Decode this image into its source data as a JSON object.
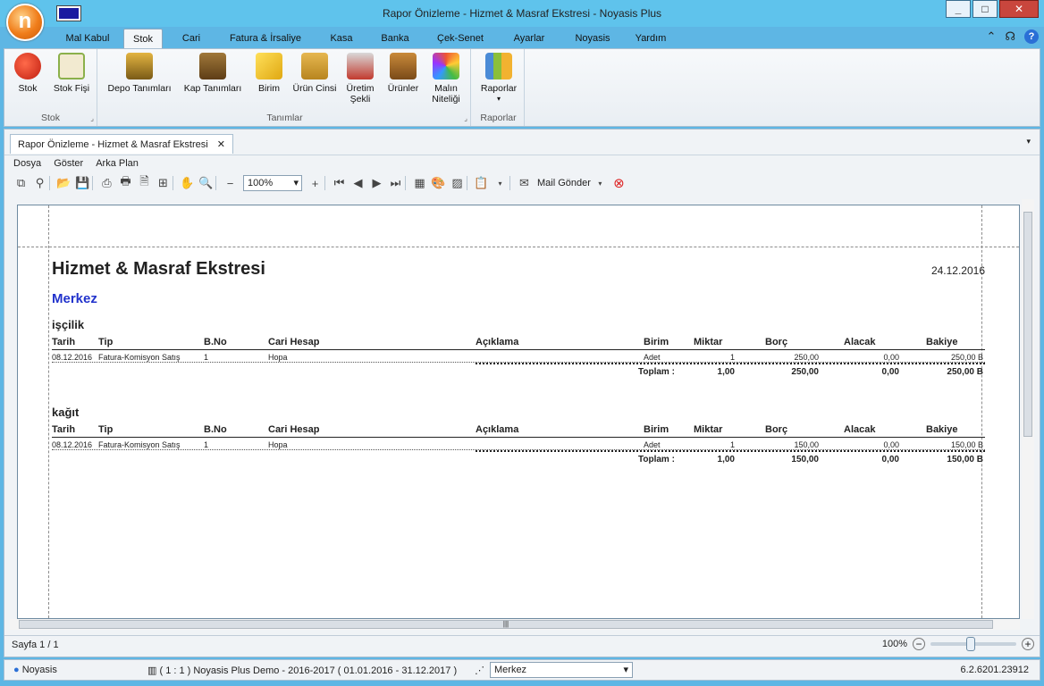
{
  "window": {
    "title": "Rapor Önizleme - Hizmet & Masraf Ekstresi - Noyasis Plus"
  },
  "ribbon_tabs": [
    "Mal Kabul",
    "Stok",
    "Cari",
    "Fatura & İrsaliye",
    "Kasa",
    "Banka",
    "Çek-Senet",
    "Ayarlar",
    "Noyasis",
    "Yardım"
  ],
  "ribbon": {
    "stok_group": {
      "label": "Stok",
      "buttons": [
        "Stok",
        "Stok Fişi"
      ]
    },
    "tanimlar_group": {
      "label": "Tanımlar",
      "buttons": [
        "Depo Tanımları",
        "Kap Tanımları",
        "Birim",
        "Ürün Cinsi",
        "Üretim Şekli",
        "Ürünler",
        "Malın Niteliği"
      ]
    },
    "raporlar_group": {
      "label": "Raporlar",
      "buttons": [
        "Raporlar"
      ]
    }
  },
  "doc_tab": {
    "label": "Rapor Önizleme - Hizmet & Masraf Ekstresi"
  },
  "menu": [
    "Dosya",
    "Göster",
    "Arka Plan"
  ],
  "toolbar": {
    "zoom": "100%",
    "mail_label": "Mail Gönder"
  },
  "report": {
    "title": "Hizmet & Masraf Ekstresi",
    "date": "24.12.2016",
    "branch": "Merkez",
    "headers": [
      "Tarih",
      "Tip",
      "B.No",
      "Cari Hesap",
      "Açıklama",
      "Birim",
      "Miktar",
      "Borç",
      "Alacak",
      "Bakiye"
    ],
    "sections": [
      {
        "name": "işçilik",
        "rows": [
          [
            "08.12.2016",
            "Fatura-Komisyon Satış",
            "1",
            "Hopa",
            "",
            "Adet",
            "1",
            "250,00",
            "0,00",
            "250,00 B"
          ]
        ],
        "total": {
          "label": "Toplam  :",
          "miktar": "1,00",
          "borc": "250,00",
          "alacak": "0,00",
          "bakiye": "250,00 B"
        }
      },
      {
        "name": "kağıt",
        "rows": [
          [
            "08.12.2016",
            "Fatura-Komisyon Satış",
            "1",
            "Hopa",
            "",
            "Adet",
            "1",
            "150,00",
            "0,00",
            "150,00 B"
          ]
        ],
        "total": {
          "label": "Toplam  :",
          "miktar": "1,00",
          "borc": "150,00",
          "alacak": "0,00",
          "bakiye": "150,00 B"
        }
      }
    ]
  },
  "statusbar": {
    "page": "Sayfa 1 / 1",
    "zoom": "100%"
  },
  "footer": {
    "user": "Noyasis",
    "db": "( 1 : 1 )  Noyasis Plus Demo - 2016-2017  ( 01.01.2016 - 31.12.2017 )",
    "branch": "Merkez",
    "version": "6.2.6201.23912"
  },
  "icons": [
    "tomato-icon",
    "list-icon",
    "warehouse-icon",
    "box-icon",
    "ruler-icon",
    "product-type-icon",
    "production-icon",
    "products-icon",
    "quality-icon",
    "chart-icon",
    "hand-icon",
    "zoom-icon",
    "mail-icon",
    "close-icon"
  ]
}
